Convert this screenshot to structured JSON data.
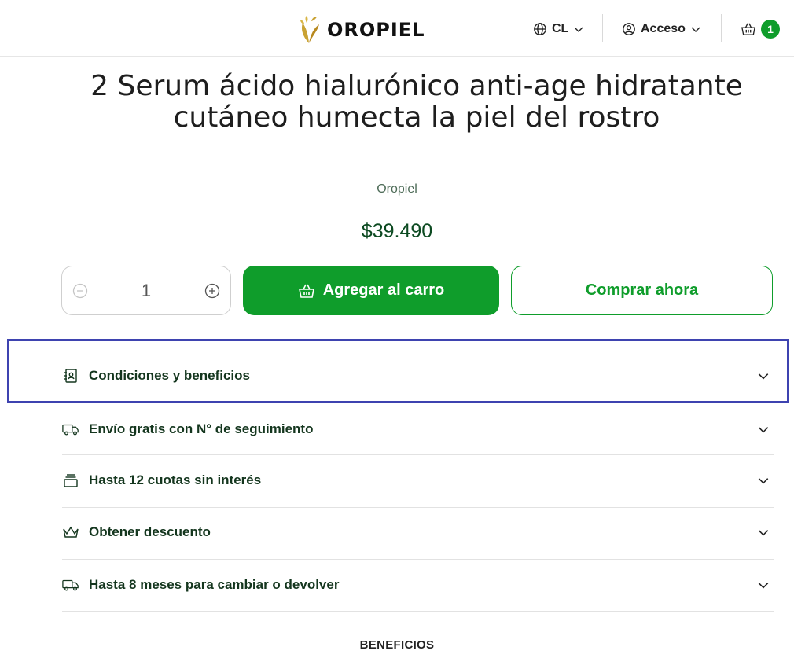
{
  "header": {
    "brand": "OROPIEL",
    "locale_label": "CL",
    "account_label": "Acceso",
    "cart_count": "1",
    "accent_color": "#0f9d2b"
  },
  "product": {
    "title": "2 Serum ácido hialurónico anti-age hidratante cutáneo humecta la piel del rostro",
    "vendor": "Oropiel",
    "price": "$39.490",
    "quantity": "1"
  },
  "actions": {
    "add_to_cart_label": "Agregar al carro",
    "buy_now_label": "Comprar ahora"
  },
  "accordion": {
    "items": [
      {
        "label": "Condiciones y beneficios",
        "icon": "contact-book-icon"
      },
      {
        "label": "Envío gratis con N° de seguimiento",
        "icon": "truck-icon"
      },
      {
        "label": "Hasta 12 cuotas sin interés",
        "icon": "card-stack-icon"
      },
      {
        "label": "Obtener descuento",
        "icon": "crown-icon"
      },
      {
        "label": "Hasta 8 meses para cambiar o devolver",
        "icon": "truck-icon"
      }
    ]
  },
  "section": {
    "benefits_heading": "BENEFICIOS"
  }
}
